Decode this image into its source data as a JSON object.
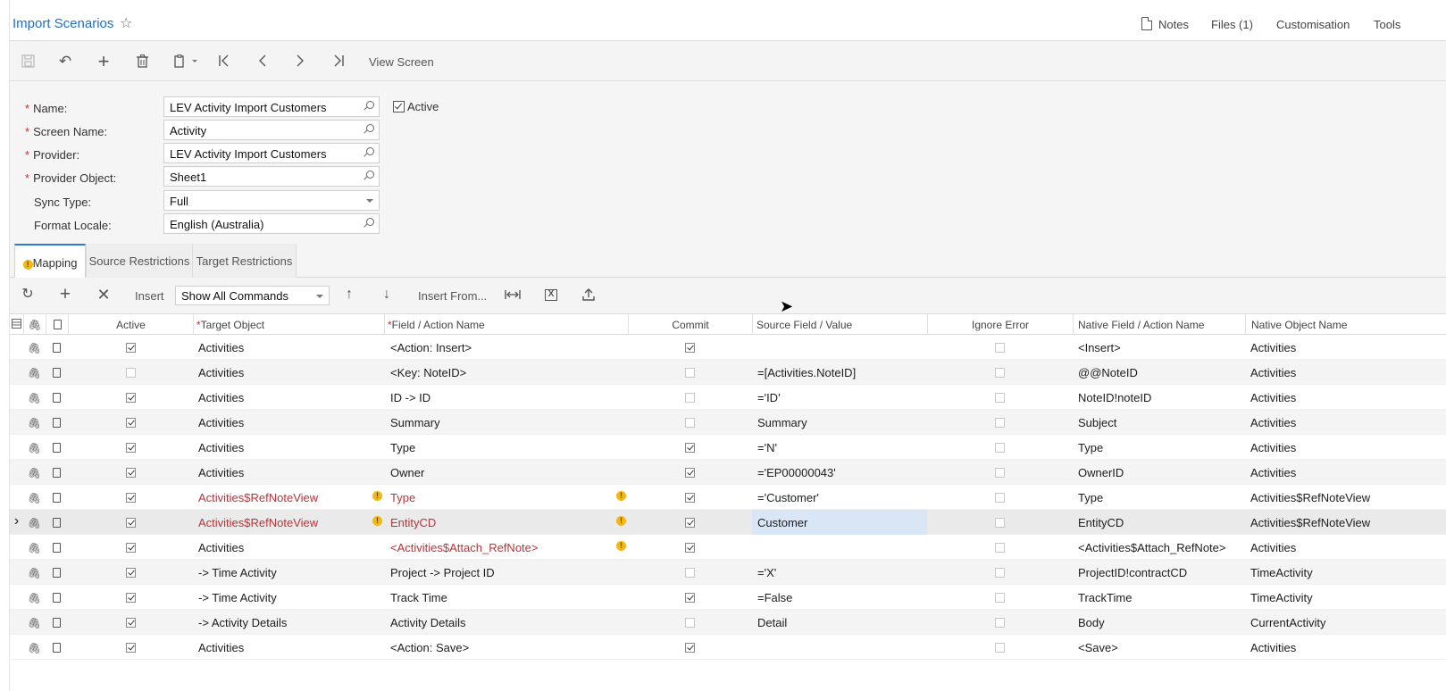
{
  "header": {
    "title": "Import Scenarios",
    "links": {
      "notes": "Notes",
      "files": "Files (1)",
      "customisation": "Customisation",
      "tools": "Tools"
    }
  },
  "toolbar": {
    "view_screen": "View Screen"
  },
  "form": {
    "name_label": "Name:",
    "name_value": "LEV Activity Import Customers",
    "screen_label": "Screen Name:",
    "screen_value": "Activity",
    "provider_label": "Provider:",
    "provider_value": "LEV Activity Import Customers",
    "provider_object_label": "Provider Object:",
    "provider_object_value": "Sheet1",
    "sync_label": "Sync Type:",
    "sync_value": "Full",
    "locale_label": "Format Locale:",
    "locale_value": "English (Australia)",
    "active_label": "Active",
    "active_checked": true,
    "required_mark": "*"
  },
  "tabs": {
    "mapping": "Mapping",
    "source": "Source Restrictions",
    "target": "Target Restrictions"
  },
  "gridbar": {
    "insert": "Insert",
    "commands": "Show All Commands",
    "insert_from": "Insert From..."
  },
  "columns": {
    "active": "Active",
    "target": "Target Object",
    "field": "Field / Action Name",
    "commit": "Commit",
    "source": "Source Field / Value",
    "ignore": "Ignore Error",
    "native_field": "Native Field / Action Name",
    "native_object": "Native Object Name"
  },
  "rows": [
    {
      "active": true,
      "target": "Activities",
      "field": "<Action: Insert>",
      "commit": true,
      "source": "",
      "ignore": false,
      "native_field": "<Insert>",
      "native_object": "Activities"
    },
    {
      "active": false,
      "target": "Activities",
      "field": "<Key: NoteID>",
      "commit": false,
      "source": "=[Activities.NoteID]",
      "ignore": false,
      "native_field": "@@NoteID",
      "native_object": "Activities"
    },
    {
      "active": true,
      "target": "Activities",
      "field": "ID -> ID",
      "commit": false,
      "source": "='ID'",
      "ignore": false,
      "native_field": "NoteID!noteID",
      "native_object": "Activities"
    },
    {
      "active": true,
      "target": "Activities",
      "field": "Summary",
      "commit": false,
      "source": "Summary",
      "ignore": false,
      "native_field": "Subject",
      "native_object": "Activities"
    },
    {
      "active": true,
      "target": "Activities",
      "field": "Type",
      "commit": true,
      "source": "='N'",
      "ignore": false,
      "native_field": "Type",
      "native_object": "Activities"
    },
    {
      "active": true,
      "target": "Activities",
      "field": "Owner",
      "commit": true,
      "source": "='EP00000043'",
      "ignore": false,
      "native_field": "OwnerID",
      "native_object": "Activities"
    },
    {
      "active": true,
      "target": "Activities$RefNoteView",
      "field": "Type",
      "commit": true,
      "source": "='Customer'",
      "ignore": false,
      "native_field": "Type",
      "native_object": "Activities$RefNoteView",
      "target_err": true,
      "field_err": true
    },
    {
      "active": true,
      "target": "Activities$RefNoteView",
      "field": "EntityCD",
      "commit": true,
      "source": "Customer",
      "ignore": false,
      "native_field": "EntityCD",
      "native_object": "Activities$RefNoteView",
      "target_err": true,
      "field_err": true,
      "current": true
    },
    {
      "active": true,
      "target": "Activities",
      "field": "<Activities$Attach_RefNote>",
      "commit": true,
      "source": "",
      "ignore": false,
      "native_field": "<Activities$Attach_RefNote>",
      "native_object": "Activities",
      "field_err": true
    },
    {
      "active": true,
      "target": "-> Time Activity",
      "field": "Project -> Project ID",
      "commit": false,
      "source": "='X'",
      "ignore": false,
      "native_field": "ProjectID!contractCD",
      "native_object": "TimeActivity"
    },
    {
      "active": true,
      "target": "-> Time Activity",
      "field": "Track Time",
      "commit": true,
      "source": "=False",
      "ignore": false,
      "native_field": "TrackTime",
      "native_object": "TimeActivity"
    },
    {
      "active": true,
      "target": "-> Activity Details",
      "field": "Activity Details",
      "commit": false,
      "source": "Detail",
      "ignore": false,
      "native_field": "Body",
      "native_object": "CurrentActivity"
    },
    {
      "active": true,
      "target": "Activities",
      "field": "<Action: Save>",
      "commit": true,
      "source": "",
      "ignore": false,
      "native_field": "<Save>",
      "native_object": "Activities"
    }
  ],
  "colors": {
    "accent": "#1f6fc5",
    "error_text": "#b8343a",
    "warning": "#f2b816",
    "selected_cell": "#d9e6f5"
  }
}
